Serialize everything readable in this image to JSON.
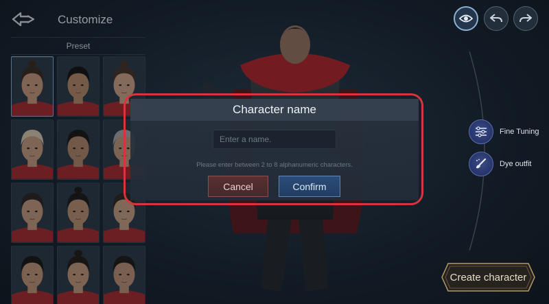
{
  "header": {
    "title": "Customize"
  },
  "preset": {
    "label": "Preset",
    "tiles": [
      {
        "hair": "#3a2a20",
        "skin": "#c99a7c",
        "bun": true
      },
      {
        "hair": "#15120f",
        "skin": "#b98a6a",
        "bun": false
      },
      {
        "hair": "#4a3526",
        "skin": "#cfa487",
        "bun": true
      },
      {
        "hair": "#d8cbb0",
        "skin": "#c79b7e",
        "bun": false
      },
      {
        "hair": "#1c1814",
        "skin": "#b48668",
        "bun": false
      },
      {
        "hair": "#a9a9a6",
        "skin": "#c49a7e",
        "bun": false
      },
      {
        "hair": "#2a2521",
        "skin": "#c59a7c",
        "bun": false
      },
      {
        "hair": "#1d1917",
        "skin": "#bd9072",
        "bun": true
      },
      {
        "hair": "#2e2620",
        "skin": "#caa084",
        "bun": false
      },
      {
        "hair": "#1a1614",
        "skin": "#c29576",
        "bun": false
      },
      {
        "hair": "#231c18",
        "skin": "#c6997a",
        "bun": true
      },
      {
        "hair": "#1e1a17",
        "skin": "#be9274",
        "bun": false
      }
    ]
  },
  "dialog": {
    "title": "Character name",
    "input_placeholder": "Enter a name.",
    "input_value": "",
    "hint": "Please enter between 2 to 8 alphanumeric characters.",
    "cancel_label": "Cancel",
    "confirm_label": "Confirm"
  },
  "side_options": [
    {
      "label": "Fine Tuning",
      "icon": "sliders-icon"
    },
    {
      "label": "Dye outfit",
      "icon": "brush-icon"
    }
  ],
  "create_label": "Create character",
  "colors": {
    "highlight": "#d8343d",
    "confirm": "#2b4c78",
    "cancel": "#5a2f30",
    "accent_gold": "#b89a66"
  }
}
